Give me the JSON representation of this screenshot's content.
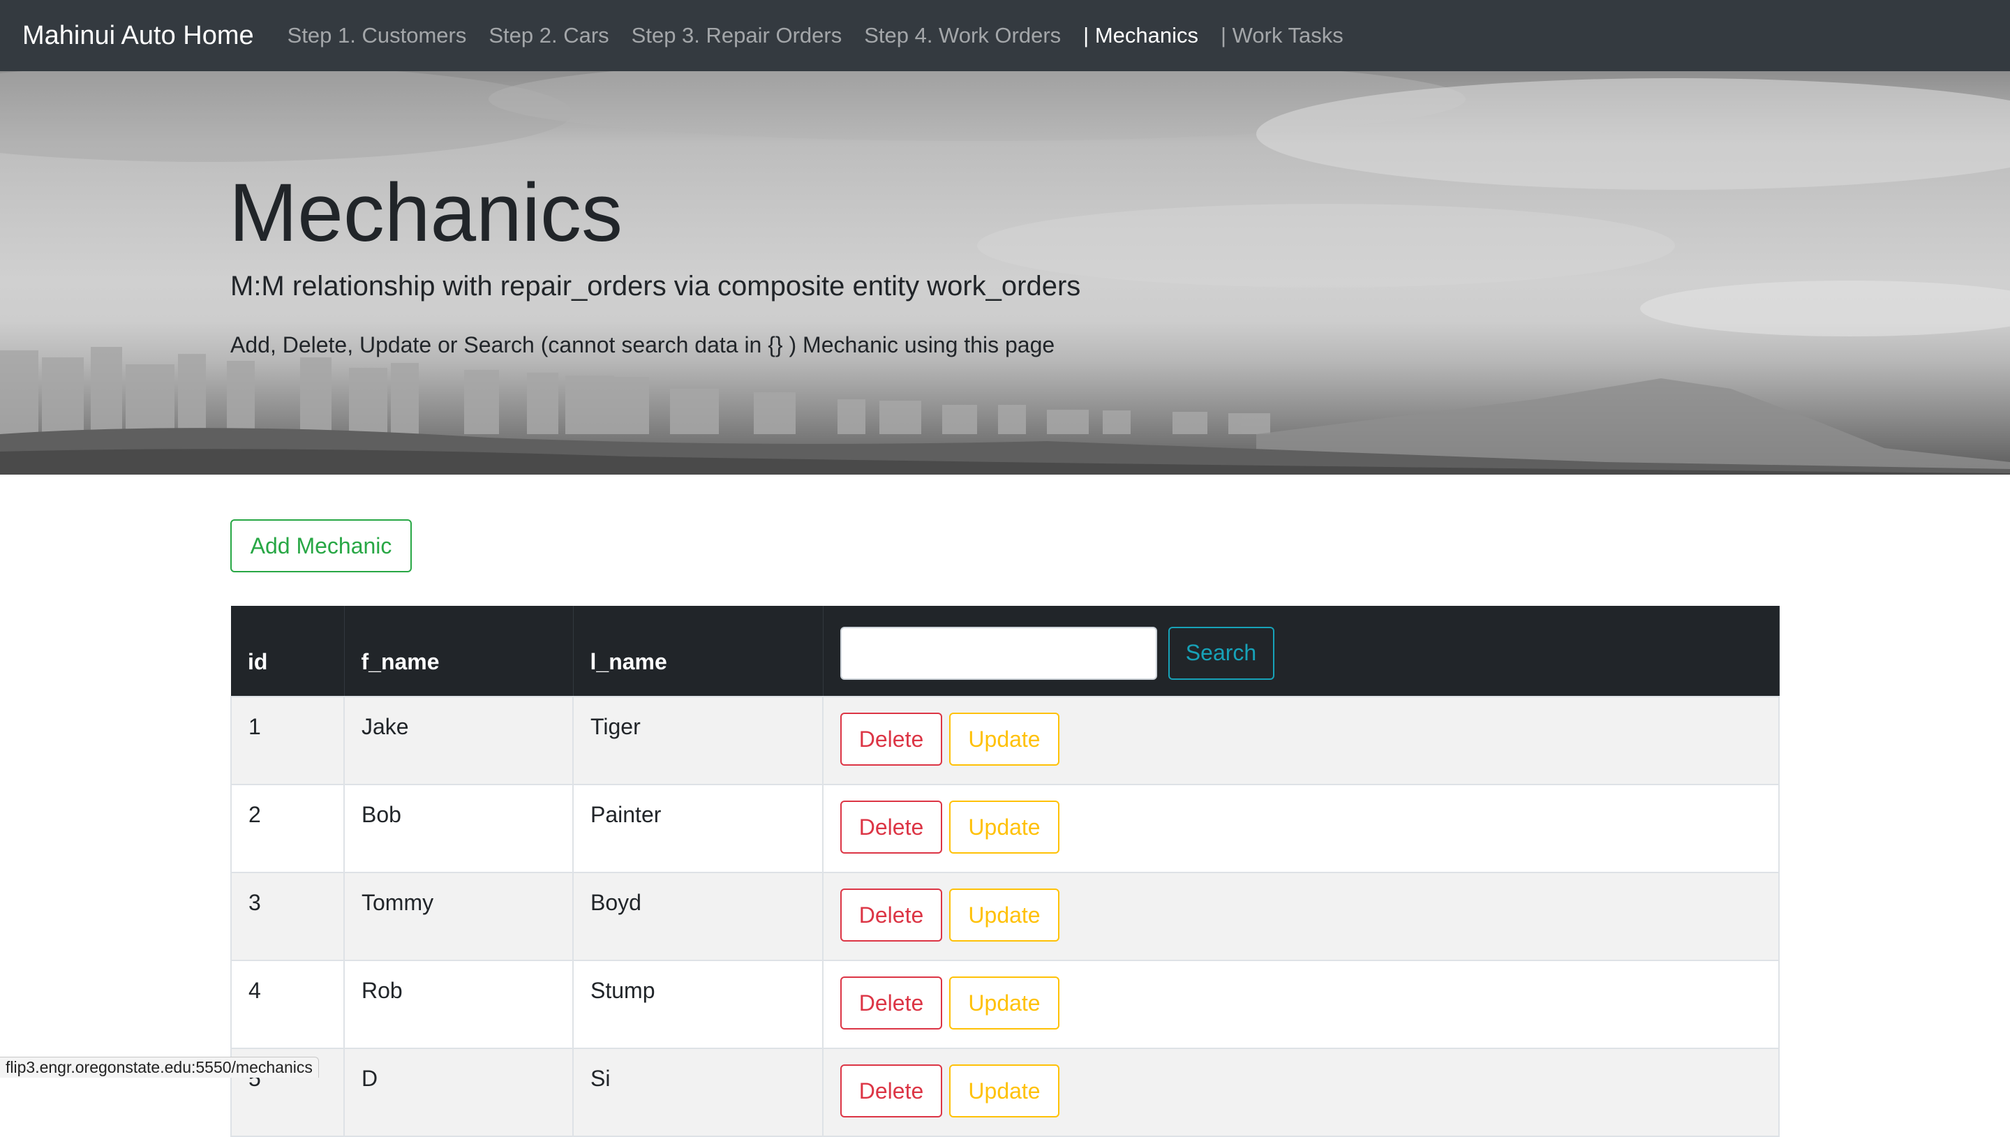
{
  "navbar": {
    "brand": "Mahinui Auto Home",
    "items": [
      {
        "label": "Step 1. Customers"
      },
      {
        "label": "Step 2. Cars"
      },
      {
        "label": "Step 3. Repair Orders"
      },
      {
        "label": "Step 4. Work Orders"
      },
      {
        "label": "| Mechanics"
      },
      {
        "label": "| Work Tasks"
      }
    ],
    "active_item": "| Mechanics"
  },
  "hero": {
    "title": "Mechanics",
    "lead": "M:M relationship with repair_orders via composite entity work_orders",
    "description": "Add, Delete, Update or Search (cannot search data in {} ) Mechanic using this page"
  },
  "add_button": "Add Mechanic",
  "table": {
    "headers": [
      "id",
      "f_name",
      "l_name"
    ],
    "search": {
      "value": "",
      "button": "Search"
    },
    "rows": [
      {
        "id": "1",
        "f_name": "Jake",
        "l_name": "Tiger"
      },
      {
        "id": "2",
        "f_name": "Bob",
        "l_name": "Painter"
      },
      {
        "id": "3",
        "f_name": "Tommy",
        "l_name": "Boyd"
      },
      {
        "id": "4",
        "f_name": "Rob",
        "l_name": "Stump"
      },
      {
        "id": "5",
        "f_name": "D",
        "l_name": "Si"
      }
    ],
    "row_actions": {
      "delete": "Delete",
      "update": "Update"
    }
  },
  "status_bar": "flip3.engr.oregonstate.edu:5550/mechanics",
  "colors": {
    "navbar_bg": "#343a40",
    "table_header_bg": "#212529",
    "add": "#28a745",
    "search": "#17a2b8",
    "delete": "#dc3545",
    "update": "#ffc107"
  }
}
